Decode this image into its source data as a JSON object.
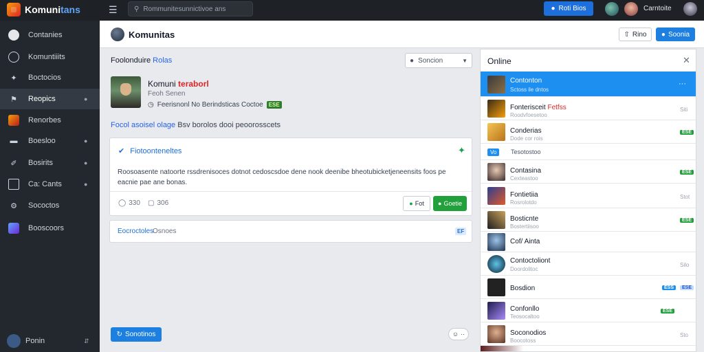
{
  "topbar": {
    "logo": "Komuni",
    "logo_accent": "tans",
    "search_placeholder": "Rommunitesunnictivoe ans",
    "create_button": "Roti Bios",
    "username": "Carntoite"
  },
  "sidebar": {
    "items": [
      {
        "label": "Contanies",
        "icon": "home-icon"
      },
      {
        "label": "Komuntiiits",
        "icon": "chat-icon"
      },
      {
        "label": "Boctocios",
        "icon": "puzzle-icon"
      },
      {
        "label": "Reopics",
        "icon": "flag-icon",
        "active": true
      },
      {
        "label": "Renorbes",
        "icon": "game-icon"
      },
      {
        "label": "Boesloo",
        "icon": "inbox-icon"
      },
      {
        "label": "Bosirits",
        "icon": "brush-icon"
      },
      {
        "label": "Ca: Cants",
        "icon": "card-icon"
      },
      {
        "label": "Sococtos",
        "icon": "settings-icon"
      },
      {
        "label": "Booscoors",
        "icon": "people-icon"
      }
    ],
    "footer_label": "Ponin"
  },
  "header": {
    "title": "Komunitas",
    "button_secondary": "Rino",
    "button_primary": "Soonia"
  },
  "main": {
    "breadcrumb_text": "Foolonduire",
    "breadcrumb_link": "Rolas",
    "sort_label": "Soncion",
    "post": {
      "name": "Komuni",
      "name_red": "teraborl",
      "subtitle": "Feoh Senen",
      "meta": "Feerisnonl No Berindsticas Coctoe",
      "meta_badge": "ESE"
    },
    "section_link": "Focol asoisel olage",
    "section_text": "Bsv borolos dooi peoorosscets",
    "card": {
      "title": "Fiotoonteneltes",
      "body": "Roosoasente natoorte rssdrenisoces dotnot cedoscsdoe dene nook deenibe bheotubicketjeneensits foos pe eacnie pae ane bonas.",
      "stat_likes": "330",
      "stat_comments": "306",
      "button_secondary": "Fot",
      "button_primary": "Goetie"
    },
    "card2": {
      "label": "Eocroctoles",
      "label2": "Osnoes",
      "tag": "EF"
    },
    "bottom_button": "Sonotinos"
  },
  "panel": {
    "title": "Online",
    "rows": [
      {
        "name": "Contonton",
        "sub": "Sctoss ile dntos",
        "status": "",
        "badge": "",
        "selected": true,
        "color": "#6b5b3e"
      },
      {
        "name": "Fonterisceit",
        "name_red": "Fetfss",
        "sub": "Roodvfoesetoo",
        "status": "Siti",
        "badge": "",
        "color": "#c48a1a"
      },
      {
        "name": "Conderias",
        "sub": "Dode cor rois",
        "status": "",
        "badge": "ESE",
        "color": "#d9a521"
      },
      {
        "tag": "Vo",
        "label": "Tesotostoo",
        "small": true
      },
      {
        "name": "Contasina",
        "sub": "Cexteastoo",
        "status": "",
        "badge": "ESE",
        "color": "#ede0d4"
      },
      {
        "name": "Fontietiia",
        "sub": "Rosrolotdo",
        "status": "Stot",
        "badge": "",
        "color": "#7a3b8c"
      },
      {
        "name": "Bosticnte",
        "sub": "Bostertiisoo",
        "status": "",
        "badge": "ESE",
        "color": "#2b2b2b"
      },
      {
        "name": "Cof/ Ainta",
        "sub": "",
        "status": "",
        "badge": "",
        "color": "#3a6fa0"
      },
      {
        "name": "Contoctoliont",
        "sub": "Doordolitoc",
        "status": "Silo",
        "badge": "",
        "color": "#1e4d6b"
      },
      {
        "name": "Bosdion",
        "sub": "",
        "status": "",
        "badge": "ESE",
        "badge_blue": "ESS",
        "color": "#222222"
      },
      {
        "name": "Confonllo",
        "sub": "Teosocaltoo",
        "status": "",
        "badge": "ESE",
        "color": "#5b3d9c"
      },
      {
        "name": "Soconodios",
        "sub": "Boocotoss",
        "status": "Sto",
        "badge": "",
        "color": "#b06a4b"
      }
    ]
  }
}
